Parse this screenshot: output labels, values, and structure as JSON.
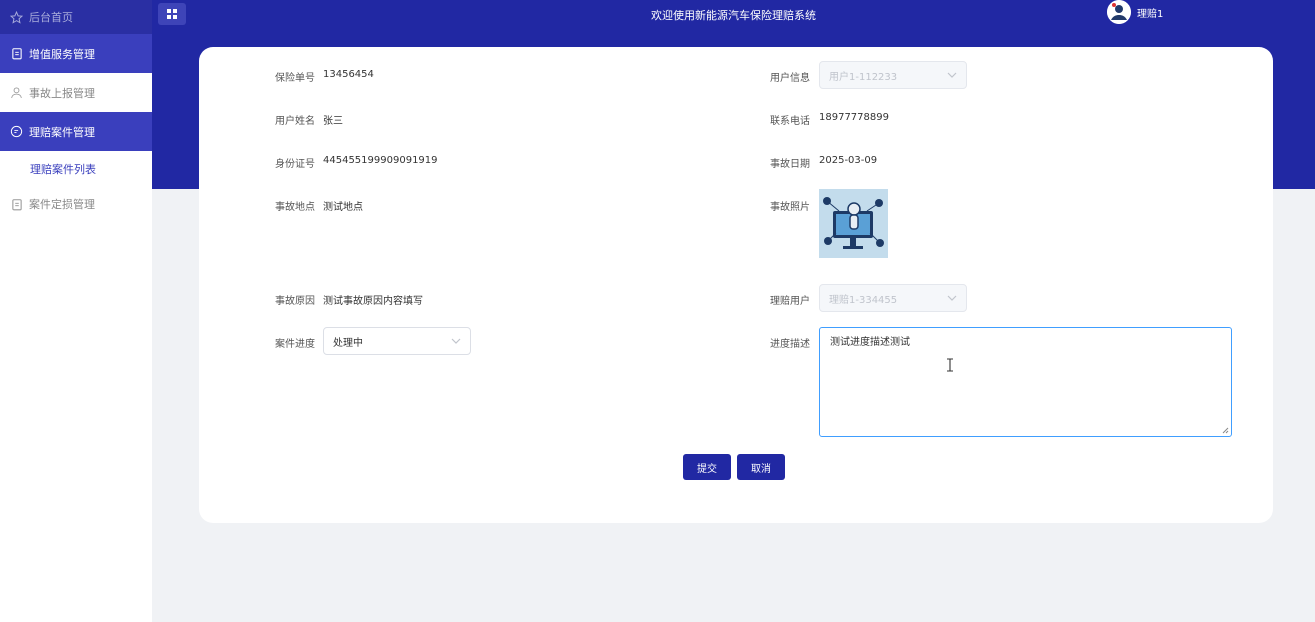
{
  "sidebar": {
    "items": [
      {
        "label": "后台首页",
        "icon": "star-icon"
      },
      {
        "label": "增值服务管理",
        "icon": "clipboard-icon"
      },
      {
        "label": "事故上报管理",
        "icon": "user-icon"
      },
      {
        "label": "理赔案件管理",
        "icon": "chat-icon"
      },
      {
        "label": "理赔案件列表"
      },
      {
        "label": "案件定损管理",
        "icon": "clipboard-icon"
      }
    ]
  },
  "header": {
    "title": "欢迎使用新能源汽车保险理赔系统",
    "menu_icon": "grid-icon",
    "username": "理赔1"
  },
  "form": {
    "policy_no": {
      "label": "保险单号",
      "value": "13456454"
    },
    "user_info": {
      "label": "用户信息",
      "value": "用户1-112233"
    },
    "user_name": {
      "label": "用户姓名",
      "value": "张三"
    },
    "phone": {
      "label": "联系电话",
      "value": "18977778899"
    },
    "id_no": {
      "label": "身份证号",
      "value": "445455199909091919"
    },
    "accident_date": {
      "label": "事故日期",
      "value": "2025-03-09"
    },
    "location": {
      "label": "事故地点",
      "value": "测试地点"
    },
    "photo": {
      "label": "事故照片"
    },
    "cause": {
      "label": "事故原因",
      "value": "测试事故原因内容填写"
    },
    "claim_user": {
      "label": "理赔用户",
      "value": "理赔1-334455"
    },
    "progress": {
      "label": "案件进度",
      "value": "处理中"
    },
    "progress_desc": {
      "label": "进度描述",
      "value": "测试进度描述测试"
    }
  },
  "actions": {
    "submit": "提交",
    "cancel": "取消"
  },
  "colors": {
    "primary": "#2128a3",
    "sidebar_active": "#3a3fbd",
    "focus_border": "#409eff"
  }
}
